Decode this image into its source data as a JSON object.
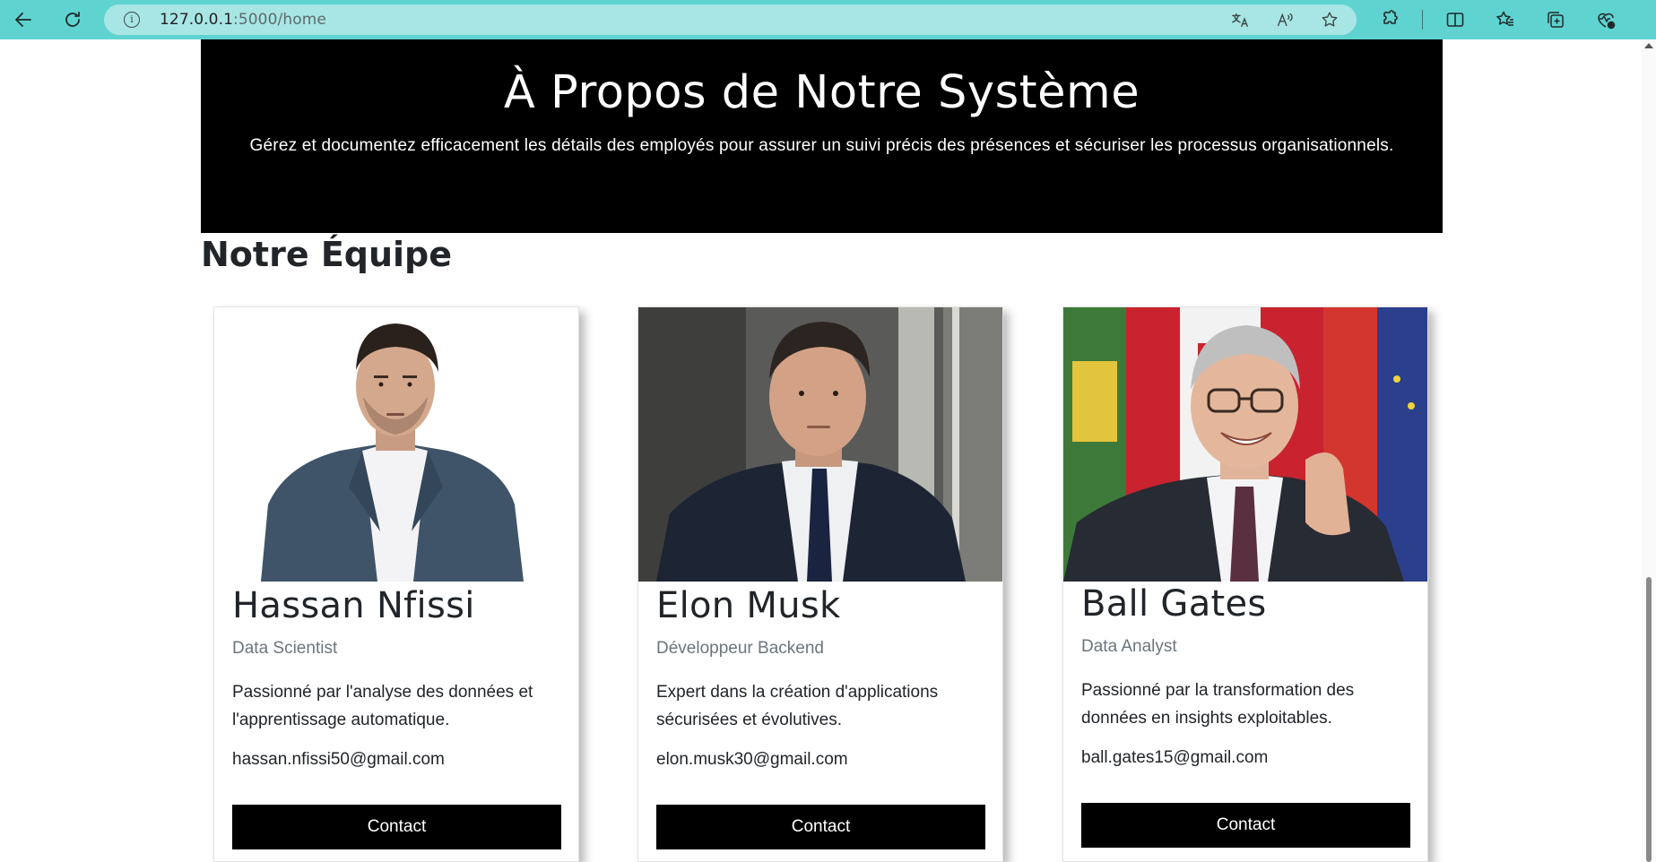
{
  "browser": {
    "url_host": "127.0.0.1",
    "url_path": ":5000/home"
  },
  "hero": {
    "title": "À Propos de Notre Système",
    "subtitle": "Gérez et documentez efficacement les détails des employés pour assurer un suivi précis des présences et sécuriser les processus organisationnels."
  },
  "team": {
    "heading": "Notre Équipe",
    "members": [
      {
        "name": "Hassan Nfissi",
        "role": "Data Scientist",
        "description": "Passionné par l'analyse des données et l'apprentissage automatique.",
        "email": "hassan.nfissi50@gmail.com",
        "button": "Contact"
      },
      {
        "name": "Elon Musk",
        "role": "Développeur Backend",
        "description": "Expert dans la création d'applications sécurisées et évolutives.",
        "email": "elon.musk30@gmail.com",
        "button": "Contact"
      },
      {
        "name": "Ball Gates",
        "role": "Data Analyst",
        "description": "Passionné par la transformation des données en insights exploitables.",
        "email": "ball.gates15@gmail.com",
        "button": "Contact"
      }
    ]
  },
  "colors": {
    "browser_bar": "#5fd3d0",
    "address_bar": "#a8e6e5",
    "hero_bg": "#000000",
    "button_bg": "#000000",
    "role_text": "#6c757d"
  },
  "icons": {
    "back": "back-arrow-icon",
    "reload": "reload-icon",
    "info": "info-icon",
    "read_aloud": "read-aloud-icon",
    "translate": "translate-icon",
    "favorite": "star-icon",
    "extensions": "puzzle-icon",
    "split_screen": "split-screen-icon",
    "favorites": "favorites-icon",
    "collections": "collections-icon",
    "browser_essentials": "heart-pulse-icon"
  }
}
